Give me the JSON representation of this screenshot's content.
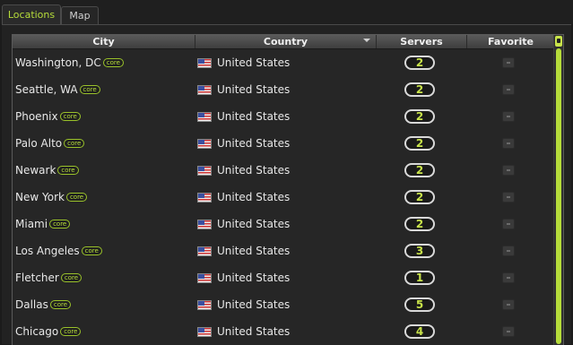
{
  "tabs": [
    {
      "label": "Locations",
      "active": true
    },
    {
      "label": "Map",
      "active": false
    }
  ],
  "columns": {
    "city": "City",
    "country": "Country",
    "servers": "Servers",
    "favorite": "Favorite"
  },
  "core_label": "core",
  "rows": [
    {
      "city": "Washington, DC",
      "country": "United States",
      "servers": "2"
    },
    {
      "city": "Seattle, WA",
      "country": "United States",
      "servers": "2"
    },
    {
      "city": "Phoenix",
      "country": "United States",
      "servers": "2"
    },
    {
      "city": "Palo Alto",
      "country": "United States",
      "servers": "2"
    },
    {
      "city": "Newark",
      "country": "United States",
      "servers": "2"
    },
    {
      "city": "New York",
      "country": "United States",
      "servers": "2"
    },
    {
      "city": "Miami",
      "country": "United States",
      "servers": "2"
    },
    {
      "city": "Los Angeles",
      "country": "United States",
      "servers": "3"
    },
    {
      "city": "Fletcher",
      "country": "United States",
      "servers": "1"
    },
    {
      "city": "Dallas",
      "country": "United States",
      "servers": "5"
    },
    {
      "city": "Chicago",
      "country": "United States",
      "servers": "4"
    }
  ],
  "colors": {
    "accent": "#b6dc3a",
    "background": "#1b1b1b"
  }
}
